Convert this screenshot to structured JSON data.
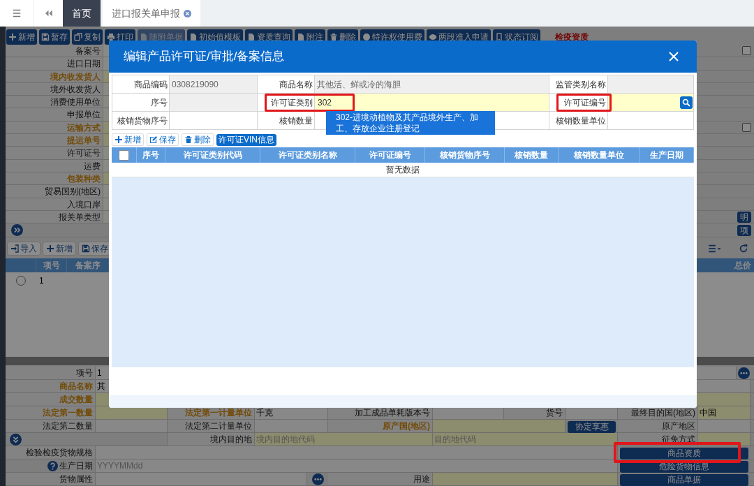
{
  "tabs": [
    {
      "label": "首页",
      "selected": true,
      "closable": false
    },
    {
      "label": "进口报关单申报",
      "selected": false,
      "closable": true
    }
  ],
  "toolbar": {
    "buttons": [
      {
        "label": "新增",
        "disabled": false
      },
      {
        "label": "暂存",
        "disabled": false
      },
      {
        "label": "复制",
        "disabled": false
      },
      {
        "label": "打印",
        "disabled": false
      },
      {
        "label": "随附单据",
        "disabled": true
      },
      {
        "label": "初始值模板",
        "disabled": false
      },
      {
        "label": "资质查询",
        "disabled": false
      },
      {
        "label": "附注",
        "disabled": false
      },
      {
        "label": "删除",
        "disabled": false
      },
      {
        "label": "特许权使用费",
        "disabled": false
      },
      {
        "label": "两段准入申请",
        "disabled": false
      },
      {
        "label": "状态订阅",
        "disabled": false
      }
    ],
    "alert": "检疫资质"
  },
  "header_form": {
    "fields": [
      {
        "label": "备案号",
        "required": false,
        "checked": false
      },
      {
        "label": "进口日期",
        "required": false
      },
      {
        "label": "境内收发货人",
        "required": true
      },
      {
        "label": "境外收发货人",
        "required": false
      },
      {
        "label": "消费使用单位",
        "required": false
      },
      {
        "label": "申报单位",
        "required": false
      },
      {
        "label": "运输方式",
        "required": true,
        "checked": false
      },
      {
        "label": "提运单号",
        "required": true
      },
      {
        "label": "许可证号",
        "required": false
      },
      {
        "label": "运费",
        "required": false
      },
      {
        "label": "包装种类",
        "required": true
      },
      {
        "label": "贸易国别(地区)",
        "required": false
      },
      {
        "label": "入境口岸",
        "required": false
      },
      {
        "label": "报关单类型",
        "required": false,
        "side_button": "明"
      }
    ],
    "expand_side_button": "项"
  },
  "goods": {
    "toolbar": [
      "导入",
      "新增",
      "保存"
    ],
    "columns": [
      "项号",
      "备案序"
    ],
    "last_column": "总价",
    "rows": [
      {
        "selected": false,
        "item": "1"
      }
    ]
  },
  "detail_form": [
    [
      {
        "kind": "label",
        "text": "项号"
      },
      {
        "kind": "value",
        "text": "1",
        "required": false
      },
      {
        "kind": "more"
      }
    ],
    [
      {
        "kind": "label",
        "text": "商品名称",
        "required": true
      },
      {
        "kind": "value",
        "text": "其",
        "required": false
      }
    ],
    [
      {
        "kind": "label",
        "text": "成交数量",
        "required": true
      },
      {
        "kind": "value",
        "required": true
      }
    ],
    [
      {
        "kind": "label",
        "text": "法定第一数量",
        "required": true
      },
      {
        "kind": "value",
        "required": true
      },
      {
        "kind": "label",
        "text": "法定第一计量单位",
        "required": true
      },
      {
        "kind": "value",
        "text": "千克",
        "required": false
      },
      {
        "kind": "label",
        "text": "加工成品单耗版本号"
      },
      {
        "kind": "value",
        "required": false
      },
      {
        "kind": "label",
        "text": "货号"
      },
      {
        "kind": "value",
        "required": false
      },
      {
        "kind": "label",
        "text": "最终目的国(地区)"
      },
      {
        "kind": "value",
        "text": "中国",
        "required": true
      }
    ],
    [
      {
        "kind": "label",
        "text": "法定第二数量"
      },
      {
        "kind": "value",
        "required": false
      },
      {
        "kind": "label",
        "text": "法定第二计量单位"
      },
      {
        "kind": "value",
        "required": false
      },
      {
        "kind": "label",
        "text": "原产国(地区)",
        "required": true
      },
      {
        "kind": "value",
        "required": true
      },
      {
        "kind": "button",
        "text": "协定享惠",
        "highlighted": false
      },
      {
        "kind": "label",
        "text": "原产地区"
      },
      {
        "kind": "value",
        "required": false
      }
    ],
    [
      {
        "kind": "expand"
      },
      {
        "kind": "label",
        "text": "境内目的地"
      },
      {
        "kind": "input",
        "placeholder": "境内目的地代码",
        "required": true
      },
      {
        "kind": "input",
        "placeholder": "目的地代码",
        "required": true
      },
      {
        "kind": "label",
        "text": "征免方式"
      },
      {
        "kind": "value",
        "required": true
      }
    ],
    [
      {
        "kind": "label",
        "text": "检验检疫货物规格"
      },
      {
        "kind": "value",
        "required": false
      },
      {
        "kind": "button",
        "text": "商品资质",
        "highlighted": true
      }
    ],
    [
      {
        "kind": "help_label",
        "text": "生产日期"
      },
      {
        "kind": "input",
        "placeholder": "YYYYMMdd",
        "required": false
      },
      {
        "kind": "button",
        "text": "危险货物信息",
        "highlighted": false
      }
    ],
    [
      {
        "kind": "label",
        "text": "货物属性"
      },
      {
        "kind": "value",
        "required": false
      },
      {
        "kind": "more"
      },
      {
        "kind": "label",
        "text": "用途"
      },
      {
        "kind": "value",
        "required": true
      },
      {
        "kind": "button",
        "text": "商品单据",
        "highlighted": false
      }
    ]
  ],
  "dialog": {
    "title": "编辑产品许可证/审批/备案信息",
    "form": [
      [
        {
          "label": "商品编码",
          "value": "0308219090",
          "readonly": true
        },
        {
          "label": "商品名称",
          "value": "其他活、鲜或冷的海胆",
          "readonly": true
        },
        {
          "label": "监管类别名称",
          "readonly": true
        }
      ],
      [
        {
          "label": "序号",
          "readonly": true
        },
        {
          "label": "许可证类别",
          "value": "302",
          "readonly": false,
          "highlighted": true
        },
        {
          "label": "许可证编号",
          "readonly": false,
          "highlighted": true,
          "search": true
        }
      ],
      [
        {
          "label": "核销货物序号",
          "readonly": false
        },
        {
          "label": "核销数量",
          "readonly": false
        },
        {
          "label": "核销数量单位",
          "readonly": false
        }
      ]
    ],
    "suggestion": "302-进境动植物及其产品境外生产、加工、存放企业注册登记",
    "toolbar": [
      {
        "label": "新增",
        "kind": "plain"
      },
      {
        "label": "保存",
        "kind": "plain"
      },
      {
        "label": "删除",
        "kind": "plain"
      },
      {
        "label": "许可证VIN信息",
        "kind": "primary"
      }
    ],
    "table": {
      "select_all": false,
      "columns": [
        "序号",
        "许可证类别代码",
        "许可证类别名称",
        "许可证编号",
        "核销货物序号",
        "核销数量",
        "核销数量单位",
        "生产日期"
      ],
      "empty_text": "暂无数据"
    }
  }
}
